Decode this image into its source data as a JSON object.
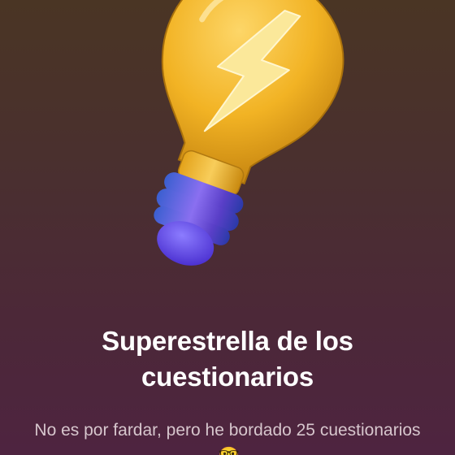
{
  "achievement": {
    "title": "Superestrella de los cuestionarios",
    "message": "No es por fardar, pero he bordado 25 cuestionarios",
    "emoji": "🤓",
    "icon": "lightbulb-lightning-icon"
  },
  "colors": {
    "background_top": "#4a3524",
    "background_bottom": "#4e2440",
    "title": "#ffffff",
    "message": "#d7c6cd",
    "bulb_glass": "#f0b21c",
    "bolt": "#fbe89a",
    "bulb_base": "#6a52d8"
  }
}
